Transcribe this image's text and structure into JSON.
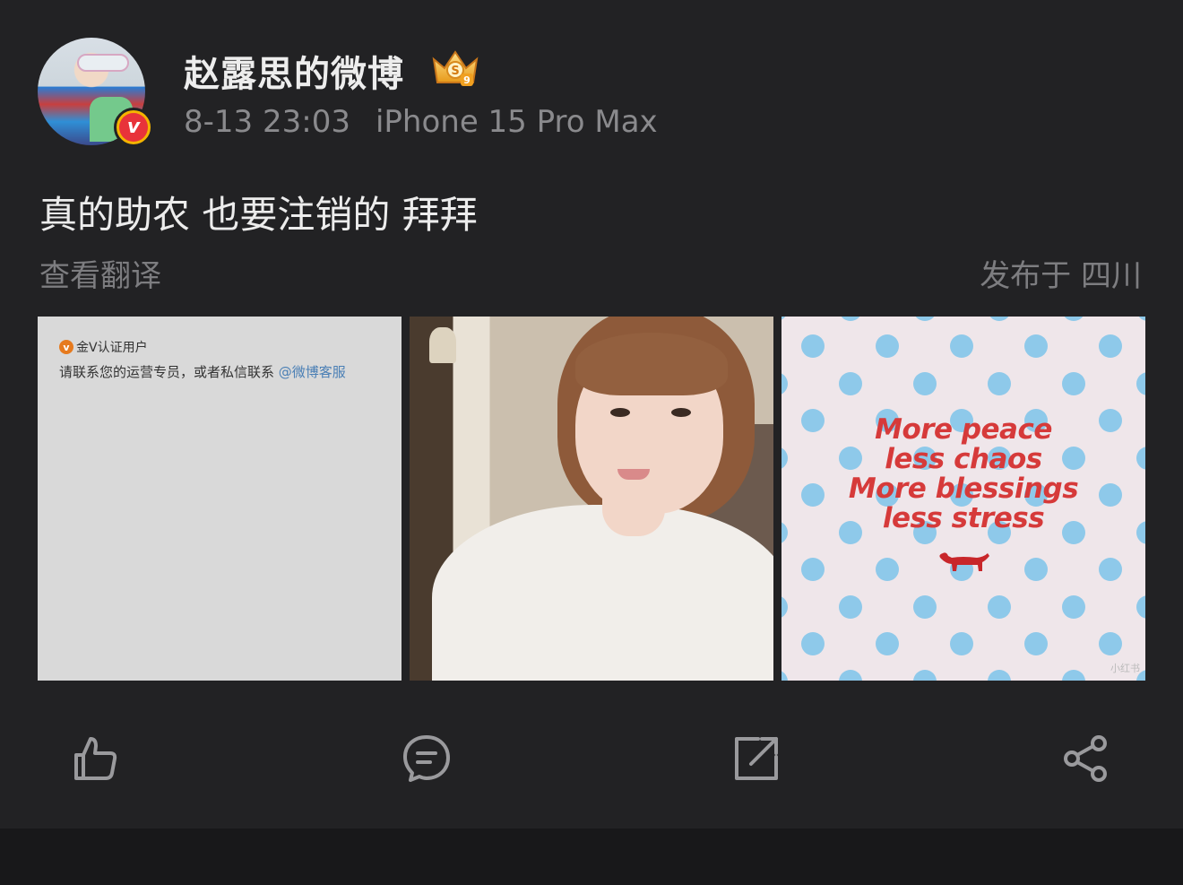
{
  "post": {
    "username": "赵露思的微博",
    "timestamp": "8-13 23:03",
    "device": "iPhone 15 Pro Max",
    "text": "真的助农 也要注销的 拜拜",
    "translate_label": "查看翻译",
    "location": "发布于 四川",
    "badges": {
      "verified_icon": "verified-v-icon",
      "crown_icon": "vip-crown-icon",
      "verified_color": "#e8333a",
      "verified_ring": "#f4b400"
    }
  },
  "images": [
    {
      "kind": "notice",
      "tag": "金V认证用户",
      "message": "请联系您的运营专员，或者私信联系",
      "mention": "@微博客服"
    },
    {
      "kind": "photo",
      "subject": "portrait"
    },
    {
      "kind": "quote-card",
      "lines": [
        "More peace",
        "less chaos",
        "More blessings",
        "less stress"
      ],
      "dot_color": "#8ec9ea",
      "text_color": "#d63a3a",
      "watermark": "小红书"
    }
  ],
  "actions": [
    {
      "name": "like",
      "icon": "thumbs-up-icon"
    },
    {
      "name": "comment",
      "icon": "comment-bubble-icon"
    },
    {
      "name": "repost",
      "icon": "repost-icon"
    },
    {
      "name": "share",
      "icon": "share-icon"
    }
  ],
  "colors": {
    "background": "#222224",
    "text_primary": "#ececec",
    "text_secondary": "#8a8a8d",
    "icon": "#9a9a9d"
  }
}
